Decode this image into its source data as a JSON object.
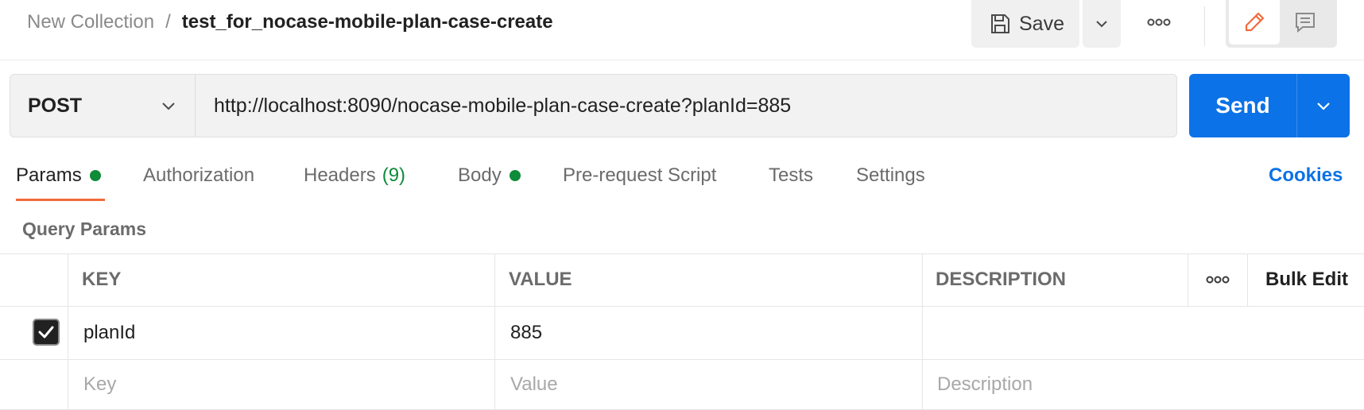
{
  "breadcrumb": {
    "collection": "New Collection",
    "separator": "/",
    "request_name": "test_for_nocase-mobile-plan-case-create"
  },
  "toolbar": {
    "save_label": "Save",
    "save_icon": "save-icon",
    "more_icon": "ellipsis-icon",
    "edit_icon": "pencil-icon",
    "comment_icon": "comment-icon"
  },
  "request": {
    "method": "POST",
    "url": "http://localhost:8090/nocase-mobile-plan-case-create?planId=885",
    "send_label": "Send"
  },
  "tabs": [
    {
      "label": "Params",
      "indicator": "dot"
    },
    {
      "label": "Authorization"
    },
    {
      "label": "Headers",
      "count": "(9)"
    },
    {
      "label": "Body",
      "indicator": "dot"
    },
    {
      "label": "Pre-request Script"
    },
    {
      "label": "Tests"
    },
    {
      "label": "Settings"
    }
  ],
  "active_tab": "Params",
  "cookies_label": "Cookies",
  "query_params": {
    "title": "Query Params",
    "columns": {
      "key": "KEY",
      "value": "VALUE",
      "description": "DESCRIPTION",
      "bulk_edit": "Bulk Edit"
    },
    "rows": [
      {
        "checked": true,
        "key": "planId",
        "value": "885",
        "description": ""
      }
    ],
    "placeholders": {
      "key": "Key",
      "value": "Value",
      "description": "Description"
    }
  },
  "colors": {
    "accent": "#0b72e7",
    "active_tab_underline": "#f26b3a",
    "indicator_green": "#0f8b3a"
  }
}
